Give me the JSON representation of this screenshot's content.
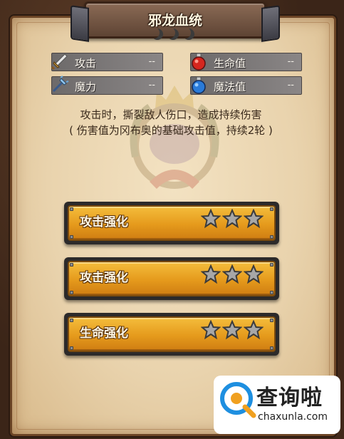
{
  "title": "邪龙血统",
  "stats": [
    {
      "label": "攻击",
      "value": "--",
      "icon": "sword-icon"
    },
    {
      "label": "生命值",
      "value": "--",
      "icon": "red-potion-icon"
    },
    {
      "label": "魔力",
      "value": "--",
      "icon": "wand-icon"
    },
    {
      "label": "魔法值",
      "value": "--",
      "icon": "blue-potion-icon"
    }
  ],
  "description": {
    "line1": "攻击时，撕裂敌人伤口，造成持续伤害",
    "line2": "( 伤害值为冈布奥的基础攻击值，持续2轮 )"
  },
  "upgrades": [
    {
      "label": "攻击强化",
      "stars": 3
    },
    {
      "label": "攻击强化",
      "stars": 3
    },
    {
      "label": "生命强化",
      "stars": 3
    }
  ],
  "watermark": {
    "text": "查询啦",
    "domain": "chaxunla.com"
  },
  "colors": {
    "parchment": "#ecd7b2",
    "button_gold": "#e89f1f",
    "stat_gray": "#7c7878"
  }
}
